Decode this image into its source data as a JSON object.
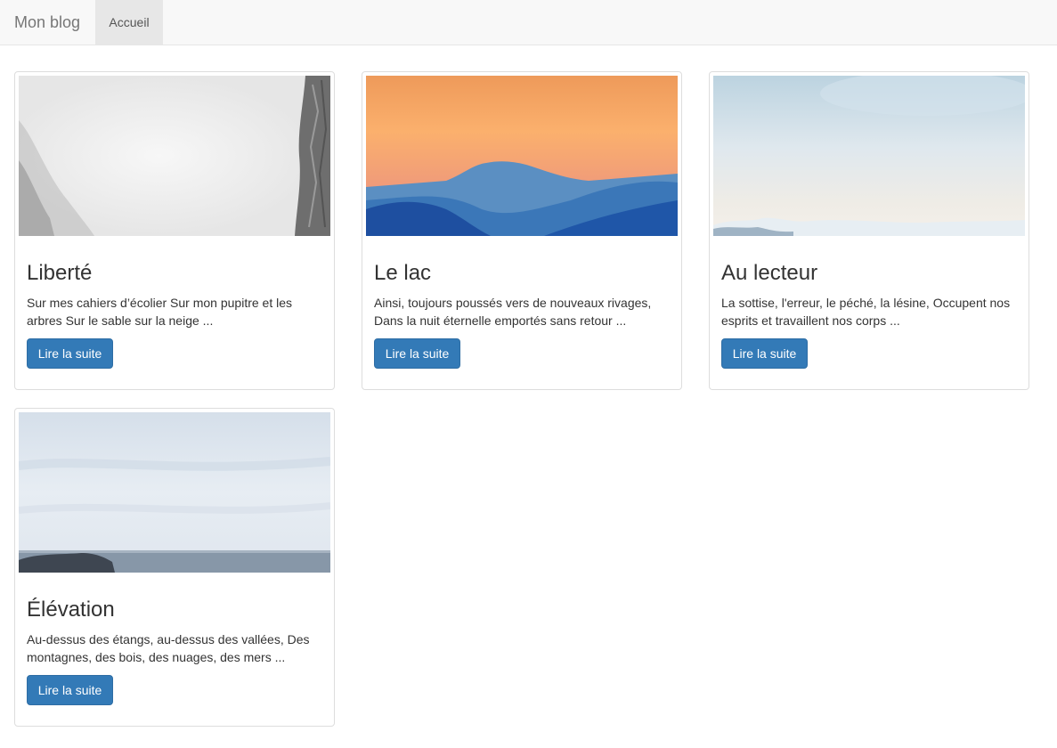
{
  "navbar": {
    "brand": "Mon blog",
    "items": [
      {
        "label": "Accueil",
        "active": true
      }
    ]
  },
  "colors": {
    "accent": "#337ab7",
    "navbar_bg": "#f8f8f8",
    "active_nav_bg": "#e7e7e7"
  },
  "posts": [
    {
      "title": "Liberté",
      "excerpt": "Sur mes cahiers d’écolier Sur mon pupitre et les arbres Sur le sable sur la neige ...",
      "button": "Lire la suite",
      "image": "misty-cliff-photo"
    },
    {
      "title": "Le lac",
      "excerpt": "Ainsi, toujours poussés vers de nouveaux rivages, Dans la nuit éternelle emportés sans retour ...",
      "button": "Lire la suite",
      "image": "sunset-mountains-photo"
    },
    {
      "title": "Au lecteur",
      "excerpt": "La sottise, l'erreur, le péché, la lésine, Occupent nos esprits et travaillent nos corps ...",
      "button": "Lire la suite",
      "image": "sky-above-clouds-photo"
    },
    {
      "title": "Élévation",
      "excerpt": "Au-dessus des étangs, au-dessus des vallées, Des montagnes, des bois, des nuages, des mers ...",
      "button": "Lire la suite",
      "image": "sea-horizon-photo"
    }
  ]
}
